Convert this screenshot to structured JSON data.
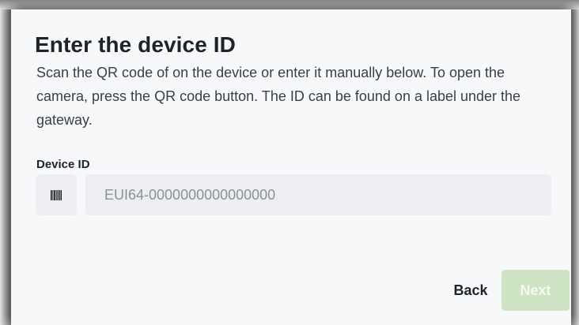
{
  "dialog": {
    "title": "Enter the device ID",
    "description": "Scan the QR code of on the device or enter it manually below. To open the camera, press the QR code button. The ID can be found on a label under the gateway."
  },
  "device_id": {
    "label": "Device ID",
    "value": "",
    "placeholder": "EUI64-0000000000000000",
    "scan_icon": "barcode-icon"
  },
  "actions": {
    "back_label": "Back",
    "next_label": "Next",
    "next_enabled": false
  },
  "colors": {
    "next_disabled_bg": "#cfe4c3",
    "text_primary": "#1f2328",
    "input_bg": "#eceef1"
  }
}
